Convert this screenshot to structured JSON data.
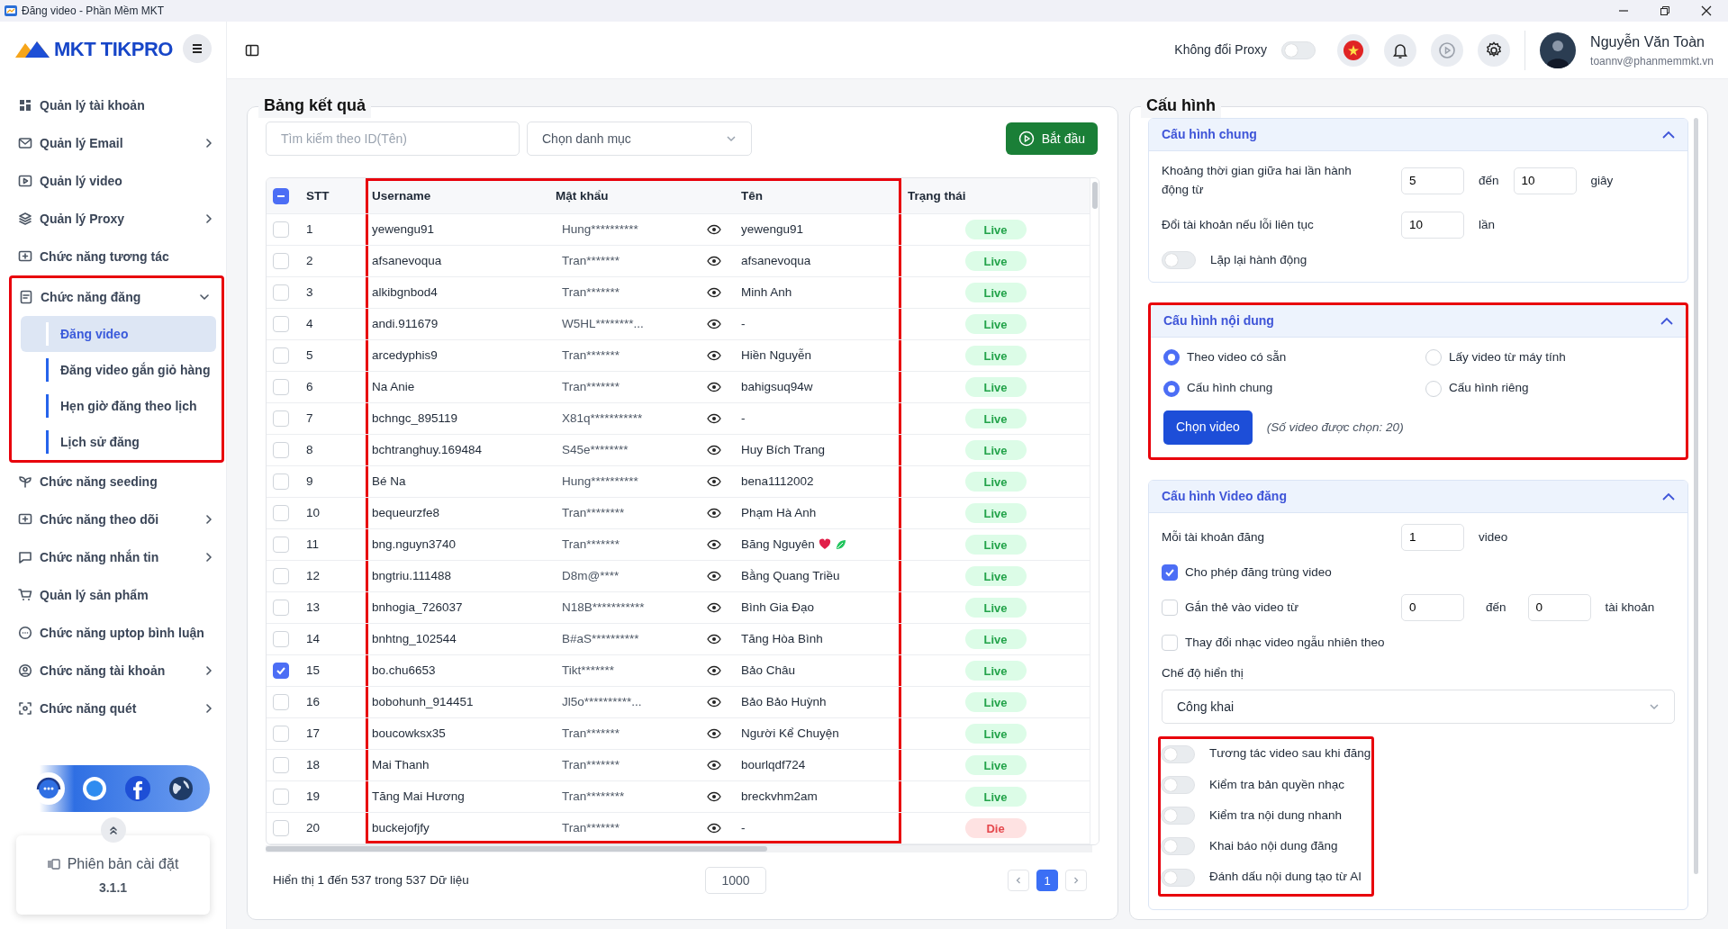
{
  "window": {
    "title": "Đăng video - Phần Mềm MKT"
  },
  "sidebar": {
    "logo": "MKT TIKPRO",
    "items": [
      {
        "label": "Quản lý tài khoản",
        "has_submenu": false
      },
      {
        "label": "Quản lý Email",
        "has_submenu": true
      },
      {
        "label": "Quản lý video",
        "has_submenu": false
      },
      {
        "label": "Quản lý Proxy",
        "has_submenu": true
      },
      {
        "label": "Chức năng tương tác",
        "has_submenu": false
      },
      {
        "label": "Chức năng đăng",
        "has_submenu": true,
        "expanded": true,
        "highlight": true,
        "children": [
          {
            "label": "Đăng video",
            "selected": true
          },
          {
            "label": "Đăng video gắn giỏ hàng",
            "selected": false
          },
          {
            "label": "Hẹn giờ đăng theo lịch",
            "selected": false
          },
          {
            "label": "Lịch sử đăng",
            "selected": false
          }
        ]
      },
      {
        "label": "Chức năng seeding",
        "has_submenu": false
      },
      {
        "label": "Chức năng theo dõi",
        "has_submenu": true
      },
      {
        "label": "Chức năng nhắn tin",
        "has_submenu": true
      },
      {
        "label": "Quản lý sản phẩm",
        "has_submenu": false
      },
      {
        "label": "Chức năng uptop bình luận",
        "has_submenu": false
      },
      {
        "label": "Chức năng tài khoản",
        "has_submenu": true
      },
      {
        "label": "Chức năng quét",
        "has_submenu": true
      }
    ],
    "version": {
      "label": "Phiên bản cài đặt",
      "number": "3.1.1"
    }
  },
  "topbar": {
    "proxy_label": "Không đổi Proxy",
    "proxy_on": false,
    "user_name": "Nguyễn Văn Toàn",
    "user_email": "toannv@phanmemmkt.vn"
  },
  "results": {
    "title": "Bảng kết quả",
    "search": {
      "placeholder": "Tìm kiếm theo ID(Tên)"
    },
    "category": {
      "value": "Chọn danh mục"
    },
    "start_button": "Bắt đầu",
    "select_all": {
      "partial": true
    },
    "columns": [
      {
        "label": "STT",
        "highlight": false
      },
      {
        "label": "Username",
        "highlight": true
      },
      {
        "label": "Mật khẩu",
        "highlight": true
      },
      {
        "label": "Tên",
        "highlight": true
      },
      {
        "label": "Trạng thái",
        "highlight": false
      }
    ],
    "rows": [
      {
        "checked": false,
        "stt": "1",
        "username": "yewengu91",
        "password": "Hung**********",
        "name": "yewengu91",
        "status": "Live",
        "kind": "live"
      },
      {
        "checked": false,
        "stt": "2",
        "username": "afsanevoqua",
        "password": "Tran*******",
        "name": "afsanevoqua",
        "status": "Live",
        "kind": "live"
      },
      {
        "checked": false,
        "stt": "3",
        "username": "alkibgnbod4",
        "password": "Tran*******",
        "name": "Minh Anh",
        "status": "Live",
        "kind": "live"
      },
      {
        "checked": false,
        "stt": "4",
        "username": "andi.911679",
        "password": "W5HL********...",
        "name": "-",
        "status": "Live",
        "kind": "live"
      },
      {
        "checked": false,
        "stt": "5",
        "username": "arcedyphis9",
        "password": "Tran*******",
        "name": "Hiền Nguyễn",
        "status": "Live",
        "kind": "live"
      },
      {
        "checked": false,
        "stt": "6",
        "username": "Na Anie",
        "password": "Tran*******",
        "name": "bahigsuq94w",
        "status": "Live",
        "kind": "live"
      },
      {
        "checked": false,
        "stt": "7",
        "username": "bchngc_895119",
        "password": "X81q***********",
        "name": "-",
        "status": "Live",
        "kind": "live"
      },
      {
        "checked": false,
        "stt": "8",
        "username": "bchtranghuy.169484",
        "password": "S45e********",
        "name": "Huy Bích Trang",
        "status": "Live",
        "kind": "live"
      },
      {
        "checked": false,
        "stt": "9",
        "username": "Bé Na",
        "password": "Hung**********",
        "name": "bena1112002",
        "status": "Live",
        "kind": "live"
      },
      {
        "checked": false,
        "stt": "10",
        "username": "bequeurzfe8",
        "password": "Tran********",
        "name": "Phạm Hà Anh",
        "status": "Live",
        "kind": "live"
      },
      {
        "checked": false,
        "stt": "11",
        "username": "bng.nguyn3740",
        "password": "Tran*******",
        "name": "Băng Nguyên",
        "emojis": [
          {
            "kind": "heart"
          },
          {
            "kind": "leaf"
          }
        ],
        "status": "Live",
        "kind": "live"
      },
      {
        "checked": false,
        "stt": "12",
        "username": "bngtriu.111488",
        "password": "D8m@****",
        "name": "Bằng Quang Triều",
        "status": "Live",
        "kind": "live"
      },
      {
        "checked": false,
        "stt": "13",
        "username": "bnhogia_726037",
        "password": "N18B***********",
        "name": "Bình Gia Đạo",
        "status": "Live",
        "kind": "live"
      },
      {
        "checked": false,
        "stt": "14",
        "username": "bnhtng_102544",
        "password": "B#aS**********",
        "name": "Tăng Hòa Bình",
        "status": "Live",
        "kind": "live"
      },
      {
        "checked": true,
        "stt": "15",
        "username": "bo.chu6653",
        "password": "Tikt*******",
        "name": "Bảo Châu",
        "status": "Live",
        "kind": "live"
      },
      {
        "checked": false,
        "stt": "16",
        "username": "bobohunh_914451",
        "password": "Jl5o**********...",
        "name": "Bảo Bảo Huỳnh",
        "status": "Live",
        "kind": "live"
      },
      {
        "checked": false,
        "stt": "17",
        "username": "boucowksx35",
        "password": "Tran*******",
        "name": "Người Kể Chuyện",
        "status": "Live",
        "kind": "live"
      },
      {
        "checked": false,
        "stt": "18",
        "username": "Mai Thanh",
        "password": "Tran*******",
        "name": "bourlqdf724",
        "status": "Live",
        "kind": "live"
      },
      {
        "checked": false,
        "stt": "19",
        "username": "Tăng Mai Hương",
        "password": "Tran********",
        "name": "breckvhm2am",
        "status": "Live",
        "kind": "live"
      },
      {
        "checked": false,
        "stt": "20",
        "username": "buckejofjfy",
        "password": "Tran*******",
        "name": "-",
        "status": "Die",
        "kind": "die"
      }
    ],
    "footer": {
      "summary": "Hiển thị 1 đến 537 trong 537 Dữ liệu",
      "page_size": "1000",
      "pages": [
        {
          "label": "1",
          "selected": true
        }
      ]
    }
  },
  "config": {
    "title": "Cấu hình",
    "sections": [
      {
        "title": "Cấu hình chung",
        "expanded": true,
        "highlight": false,
        "rows": [
          {
            "kind": "range",
            "label": "Khoảng thời gian giữa hai lần hành động từ",
            "from": "5",
            "sep": "đến",
            "to": "10",
            "unit": "giây"
          },
          {
            "kind": "number",
            "label": "Đổi tài khoản nếu lỗi liên tục",
            "value": "10",
            "unit": "lần"
          },
          {
            "kind": "toggle",
            "label": "Lặp lại hành động",
            "on": false
          }
        ]
      },
      {
        "title": "Cấu hình nội dung",
        "expanded": true,
        "highlight": true,
        "rows": [
          {
            "kind": "radios",
            "options": [
              {
                "label": "Theo video có sẵn",
                "selected": true
              },
              {
                "label": "Lấy video từ máy tính",
                "selected": false
              }
            ]
          },
          {
            "kind": "radios",
            "options": [
              {
                "label": "Cấu hình chung",
                "selected": true
              },
              {
                "label": "Cấu hình riêng",
                "selected": false
              }
            ]
          },
          {
            "kind": "button",
            "label": "Chọn video",
            "note": "(Số video được chọn: 20)"
          }
        ]
      },
      {
        "title": "Cấu hình Video đăng",
        "expanded": true,
        "highlight": false,
        "rows": [
          {
            "kind": "number",
            "label": "Mỗi tài khoản đăng",
            "value": "1",
            "unit": "video"
          },
          {
            "kind": "check",
            "label": "Cho phép đăng trùng video",
            "checked": true
          },
          {
            "kind": "check_range",
            "label": "Gắn thẻ vào video từ",
            "checked": false,
            "from": "0",
            "sep": "đến",
            "to": "0",
            "unit": "tài khoản"
          },
          {
            "kind": "check",
            "label": "Thay đổi nhạc video ngẫu nhiên theo",
            "checked": false
          },
          {
            "kind": "select",
            "label": "Chế độ hiển thị",
            "value": "Công khai"
          },
          {
            "kind": "toggles",
            "highlight": true,
            "items": [
              {
                "label": "Tương tác video sau khi đăng",
                "on": false
              },
              {
                "label": "Kiểm tra bản quyền nhạc",
                "on": false
              },
              {
                "label": "Kiểm tra nội dung nhanh",
                "on": false
              },
              {
                "label": "Khai báo nội dung đăng",
                "on": false
              },
              {
                "label": "Đánh dấu nội dung tạo từ AI",
                "on": false
              }
            ]
          }
        ]
      }
    ]
  }
}
